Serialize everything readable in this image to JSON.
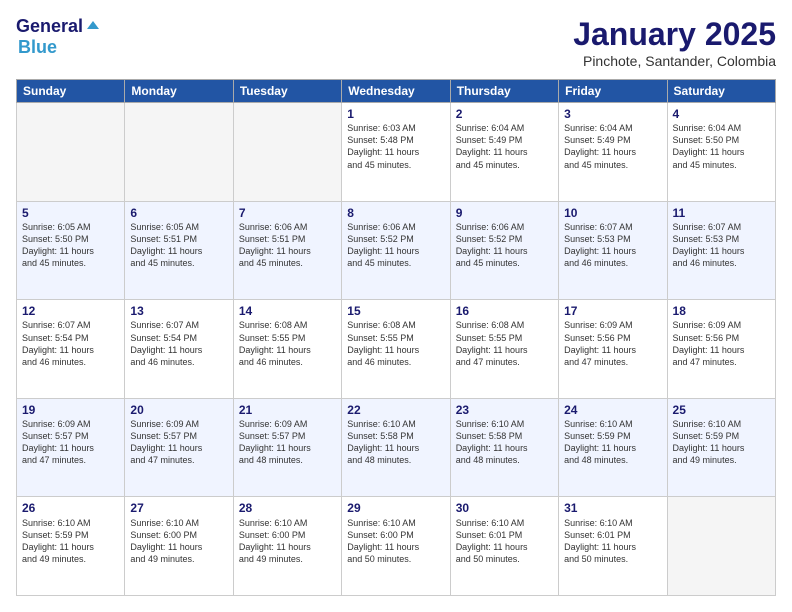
{
  "header": {
    "logo_line1": "General",
    "logo_line2": "Blue",
    "month_title": "January 2025",
    "location": "Pinchote, Santander, Colombia"
  },
  "days_of_week": [
    "Sunday",
    "Monday",
    "Tuesday",
    "Wednesday",
    "Thursday",
    "Friday",
    "Saturday"
  ],
  "weeks": [
    {
      "days": [
        {
          "num": "",
          "info": ""
        },
        {
          "num": "",
          "info": ""
        },
        {
          "num": "",
          "info": ""
        },
        {
          "num": "1",
          "info": "Sunrise: 6:03 AM\nSunset: 5:48 PM\nDaylight: 11 hours\nand 45 minutes."
        },
        {
          "num": "2",
          "info": "Sunrise: 6:04 AM\nSunset: 5:49 PM\nDaylight: 11 hours\nand 45 minutes."
        },
        {
          "num": "3",
          "info": "Sunrise: 6:04 AM\nSunset: 5:49 PM\nDaylight: 11 hours\nand 45 minutes."
        },
        {
          "num": "4",
          "info": "Sunrise: 6:04 AM\nSunset: 5:50 PM\nDaylight: 11 hours\nand 45 minutes."
        }
      ]
    },
    {
      "days": [
        {
          "num": "5",
          "info": "Sunrise: 6:05 AM\nSunset: 5:50 PM\nDaylight: 11 hours\nand 45 minutes."
        },
        {
          "num": "6",
          "info": "Sunrise: 6:05 AM\nSunset: 5:51 PM\nDaylight: 11 hours\nand 45 minutes."
        },
        {
          "num": "7",
          "info": "Sunrise: 6:06 AM\nSunset: 5:51 PM\nDaylight: 11 hours\nand 45 minutes."
        },
        {
          "num": "8",
          "info": "Sunrise: 6:06 AM\nSunset: 5:52 PM\nDaylight: 11 hours\nand 45 minutes."
        },
        {
          "num": "9",
          "info": "Sunrise: 6:06 AM\nSunset: 5:52 PM\nDaylight: 11 hours\nand 45 minutes."
        },
        {
          "num": "10",
          "info": "Sunrise: 6:07 AM\nSunset: 5:53 PM\nDaylight: 11 hours\nand 46 minutes."
        },
        {
          "num": "11",
          "info": "Sunrise: 6:07 AM\nSunset: 5:53 PM\nDaylight: 11 hours\nand 46 minutes."
        }
      ]
    },
    {
      "days": [
        {
          "num": "12",
          "info": "Sunrise: 6:07 AM\nSunset: 5:54 PM\nDaylight: 11 hours\nand 46 minutes."
        },
        {
          "num": "13",
          "info": "Sunrise: 6:07 AM\nSunset: 5:54 PM\nDaylight: 11 hours\nand 46 minutes."
        },
        {
          "num": "14",
          "info": "Sunrise: 6:08 AM\nSunset: 5:55 PM\nDaylight: 11 hours\nand 46 minutes."
        },
        {
          "num": "15",
          "info": "Sunrise: 6:08 AM\nSunset: 5:55 PM\nDaylight: 11 hours\nand 46 minutes."
        },
        {
          "num": "16",
          "info": "Sunrise: 6:08 AM\nSunset: 5:55 PM\nDaylight: 11 hours\nand 47 minutes."
        },
        {
          "num": "17",
          "info": "Sunrise: 6:09 AM\nSunset: 5:56 PM\nDaylight: 11 hours\nand 47 minutes."
        },
        {
          "num": "18",
          "info": "Sunrise: 6:09 AM\nSunset: 5:56 PM\nDaylight: 11 hours\nand 47 minutes."
        }
      ]
    },
    {
      "days": [
        {
          "num": "19",
          "info": "Sunrise: 6:09 AM\nSunset: 5:57 PM\nDaylight: 11 hours\nand 47 minutes."
        },
        {
          "num": "20",
          "info": "Sunrise: 6:09 AM\nSunset: 5:57 PM\nDaylight: 11 hours\nand 47 minutes."
        },
        {
          "num": "21",
          "info": "Sunrise: 6:09 AM\nSunset: 5:57 PM\nDaylight: 11 hours\nand 48 minutes."
        },
        {
          "num": "22",
          "info": "Sunrise: 6:10 AM\nSunset: 5:58 PM\nDaylight: 11 hours\nand 48 minutes."
        },
        {
          "num": "23",
          "info": "Sunrise: 6:10 AM\nSunset: 5:58 PM\nDaylight: 11 hours\nand 48 minutes."
        },
        {
          "num": "24",
          "info": "Sunrise: 6:10 AM\nSunset: 5:59 PM\nDaylight: 11 hours\nand 48 minutes."
        },
        {
          "num": "25",
          "info": "Sunrise: 6:10 AM\nSunset: 5:59 PM\nDaylight: 11 hours\nand 49 minutes."
        }
      ]
    },
    {
      "days": [
        {
          "num": "26",
          "info": "Sunrise: 6:10 AM\nSunset: 5:59 PM\nDaylight: 11 hours\nand 49 minutes."
        },
        {
          "num": "27",
          "info": "Sunrise: 6:10 AM\nSunset: 6:00 PM\nDaylight: 11 hours\nand 49 minutes."
        },
        {
          "num": "28",
          "info": "Sunrise: 6:10 AM\nSunset: 6:00 PM\nDaylight: 11 hours\nand 49 minutes."
        },
        {
          "num": "29",
          "info": "Sunrise: 6:10 AM\nSunset: 6:00 PM\nDaylight: 11 hours\nand 50 minutes."
        },
        {
          "num": "30",
          "info": "Sunrise: 6:10 AM\nSunset: 6:01 PM\nDaylight: 11 hours\nand 50 minutes."
        },
        {
          "num": "31",
          "info": "Sunrise: 6:10 AM\nSunset: 6:01 PM\nDaylight: 11 hours\nand 50 minutes."
        },
        {
          "num": "",
          "info": ""
        }
      ]
    }
  ]
}
